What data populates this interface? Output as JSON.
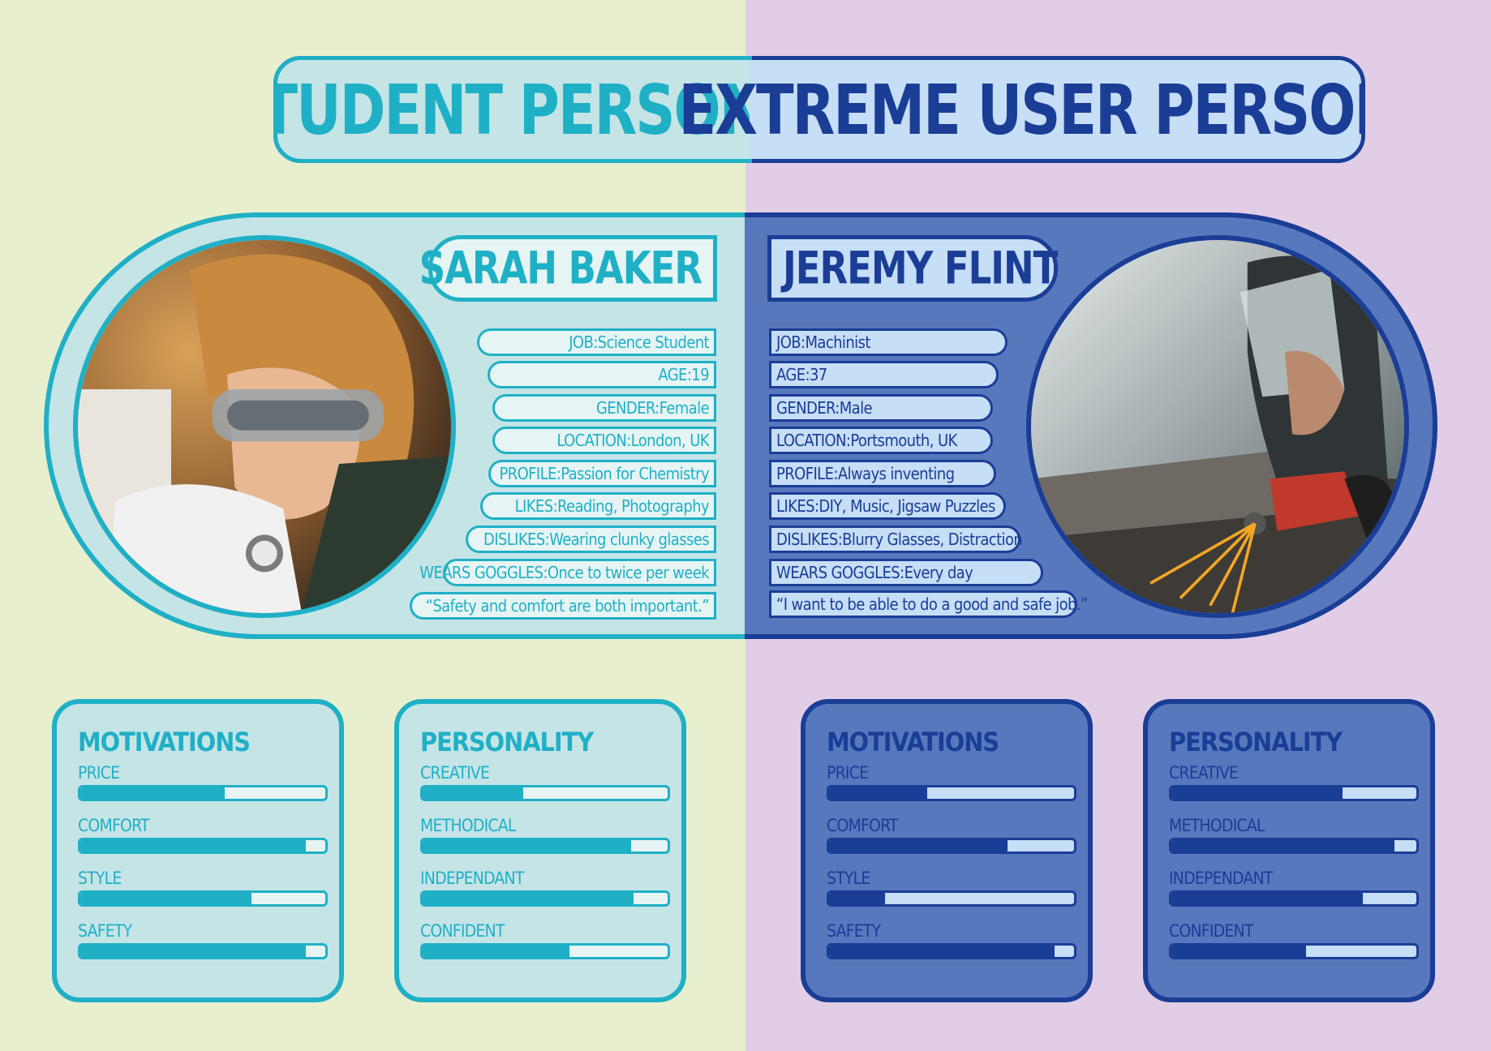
{
  "titles": {
    "student": "STUDENT PERSONA",
    "extreme": "EXTREME USER PERSONA"
  },
  "student": {
    "name": "SARAH BAKER",
    "attributes": [
      {
        "label": "JOB:",
        "value": " Science Student"
      },
      {
        "label": "AGE:",
        "value": " 19"
      },
      {
        "label": "GENDER:",
        "value": " Female"
      },
      {
        "label": "LOCATION:",
        "value": " London, UK"
      },
      {
        "label": "PROFILE:",
        "value": " Passion for Chemistry"
      },
      {
        "label": "LIKES:",
        "value": " Reading, Photography"
      },
      {
        "label": "DISLIKES:",
        "value": " Wearing clunky glasses"
      },
      {
        "label": "WEARs GOGGLES:",
        "value": " Once to twice per week"
      },
      {
        "label": "",
        "value": "“Safety and comfort are both important.”"
      }
    ],
    "motivations": {
      "title": "MOTIVATIONS",
      "items": [
        {
          "label": "PRICE",
          "value": 0.59
        },
        {
          "label": "COMFORT",
          "value": 0.92
        },
        {
          "label": "STYLE",
          "value": 0.7
        },
        {
          "label": "SAFETY",
          "value": 0.92
        }
      ]
    },
    "personality": {
      "title": "PERSONALITY",
      "items": [
        {
          "label": "CREATIVE",
          "value": 0.41
        },
        {
          "label": "METHODICAL",
          "value": 0.85
        },
        {
          "label": "INDEPENDANT",
          "value": 0.86
        },
        {
          "label": "CONFIDENT",
          "value": 0.6
        }
      ]
    }
  },
  "extreme": {
    "name": "JEREMY FLINT",
    "attributes": [
      {
        "label": "JOB:",
        "value": " Machinist"
      },
      {
        "label": "AGE:",
        "value": " 37"
      },
      {
        "label": "GENDER:",
        "value": " Male"
      },
      {
        "label": "LOCATION:",
        "value": " Portsmouth, UK"
      },
      {
        "label": "PROFILE:",
        "value": " Always inventing"
      },
      {
        "label": "LIKES:",
        "value": " DIY, Music, Jigsaw Puzzles"
      },
      {
        "label": "DISLIKES:",
        "value": " Blurry Glasses, Distraction"
      },
      {
        "label": "WEARS GOGGLES:",
        "value": " Every day"
      },
      {
        "label": "",
        "value": "“I want to be able to do a good and safe job.”"
      }
    ],
    "motivations": {
      "title": "MOTIVATIONS",
      "items": [
        {
          "label": "PRICE",
          "value": 0.4
        },
        {
          "label": "COMFORT",
          "value": 0.73
        },
        {
          "label": "STYLE",
          "value": 0.23
        },
        {
          "label": "SAFETY",
          "value": 0.92
        }
      ]
    },
    "personality": {
      "title": "PERSONALITY",
      "items": [
        {
          "label": "CREATIVE",
          "value": 0.7
        },
        {
          "label": "METHODICAL",
          "value": 0.91
        },
        {
          "label": "INDEPENDANT",
          "value": 0.78
        },
        {
          "label": "CONFIDENT",
          "value": 0.55
        }
      ]
    }
  }
}
